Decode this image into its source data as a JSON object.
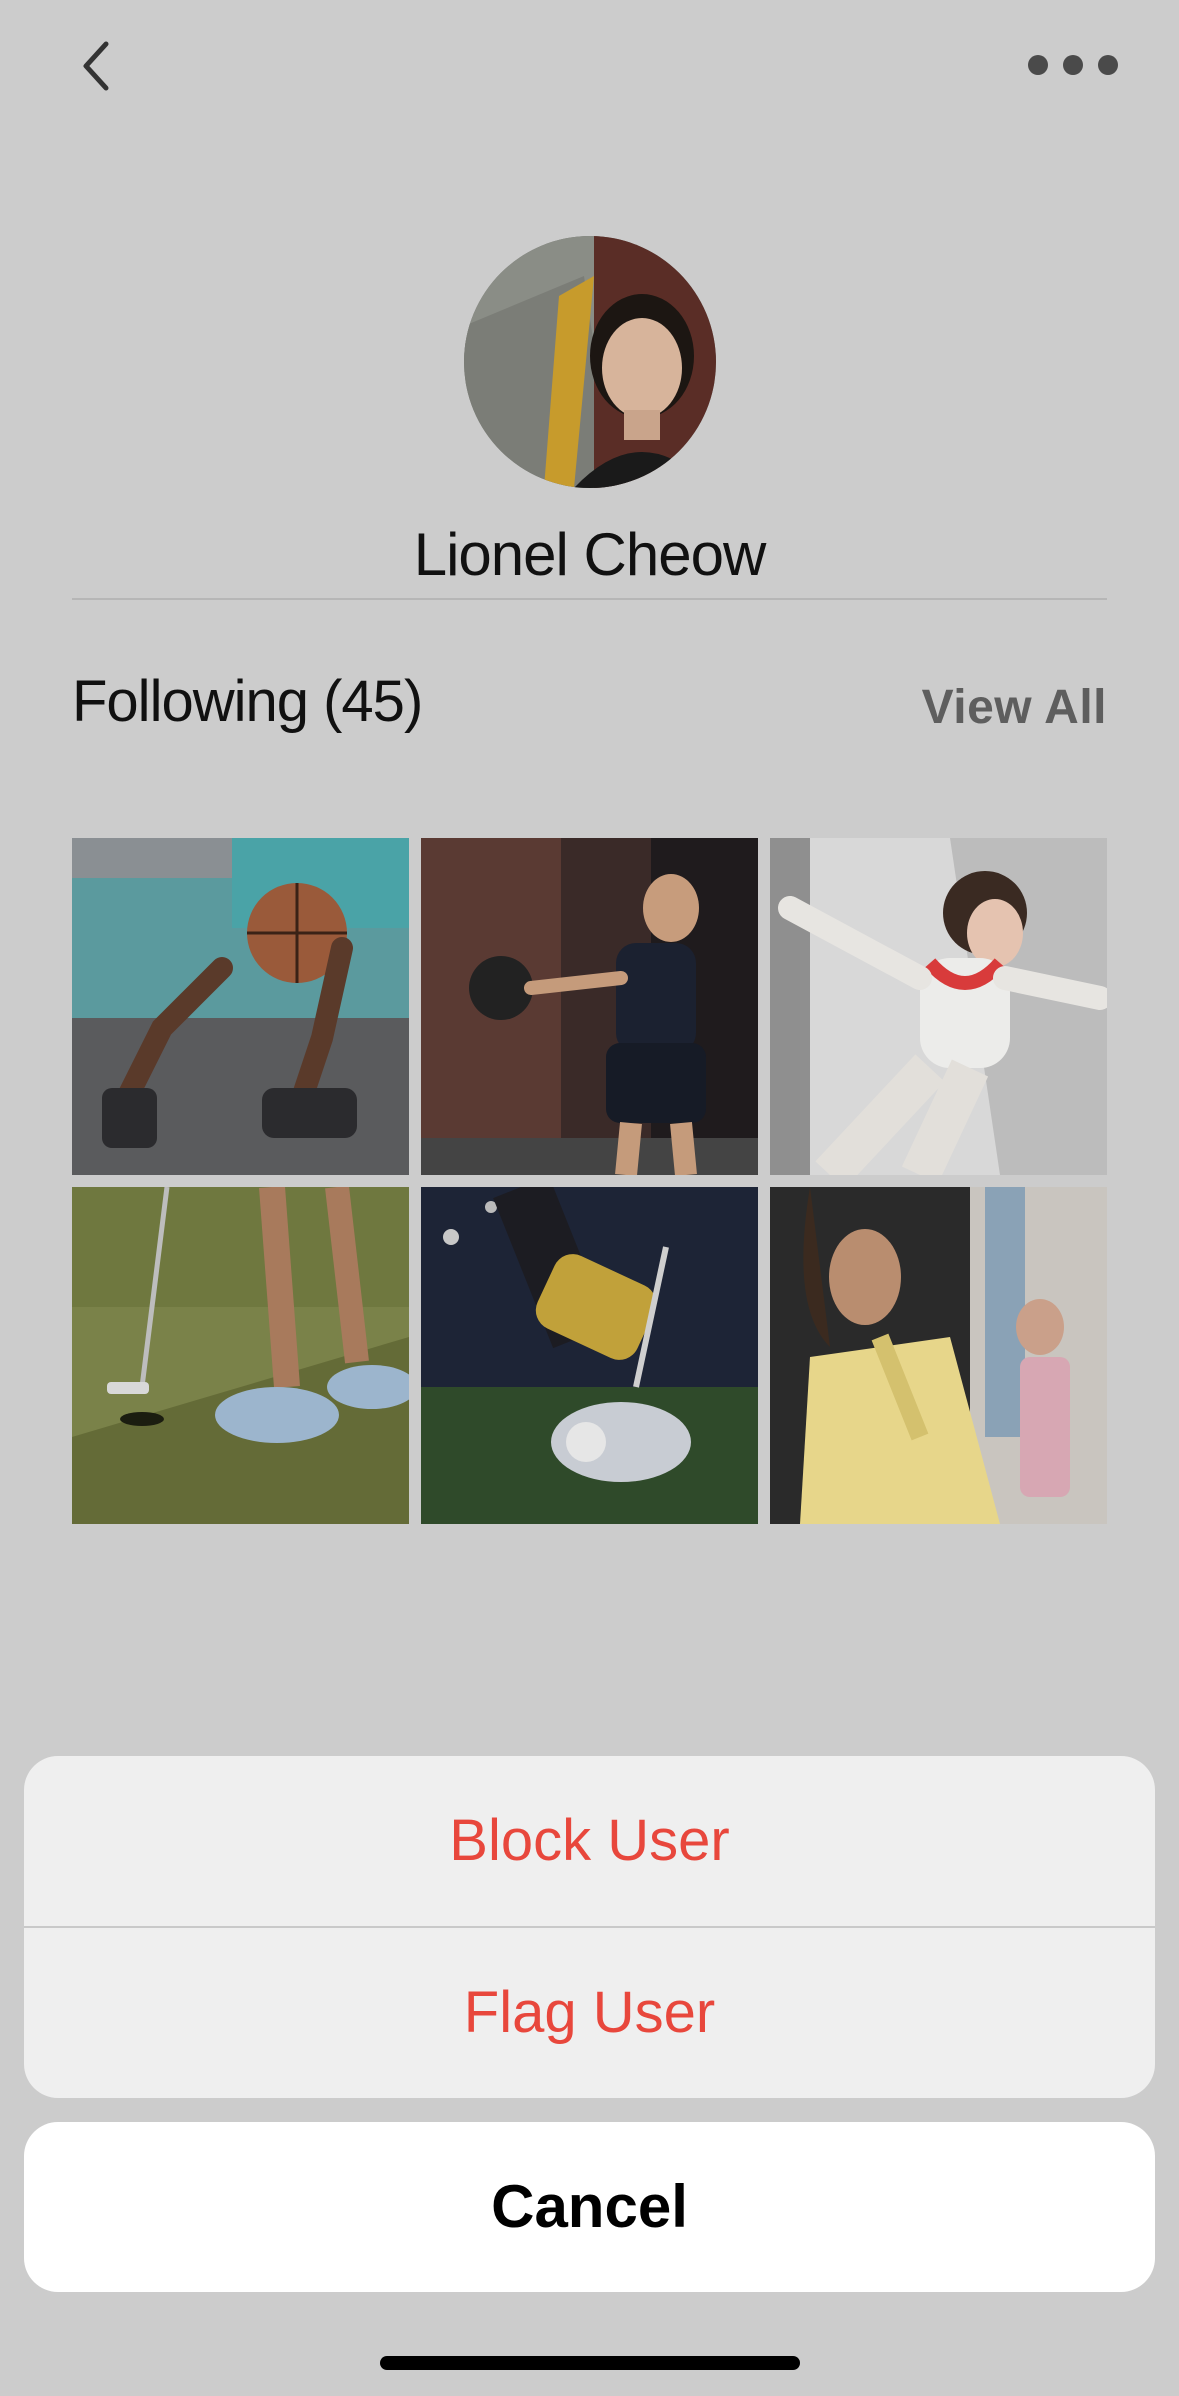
{
  "header": {
    "back_icon": "chevron-left-icon",
    "more_icon": "ellipsis-icon"
  },
  "profile": {
    "name": "Lionel Cheow"
  },
  "following": {
    "title": "Following (45)",
    "view_all": "View All",
    "tiles": [
      "basketball-player-photo",
      "kettlebell-workout-photo",
      "dancer-stretch-photo",
      "golf-putting-photo",
      "lacrosse-glove-photo",
      "yellow-jacket-model-photo"
    ]
  },
  "action_sheet": {
    "block_label": "Block User",
    "flag_label": "Flag User",
    "cancel_label": "Cancel",
    "destructive_color": "#e8473c"
  }
}
